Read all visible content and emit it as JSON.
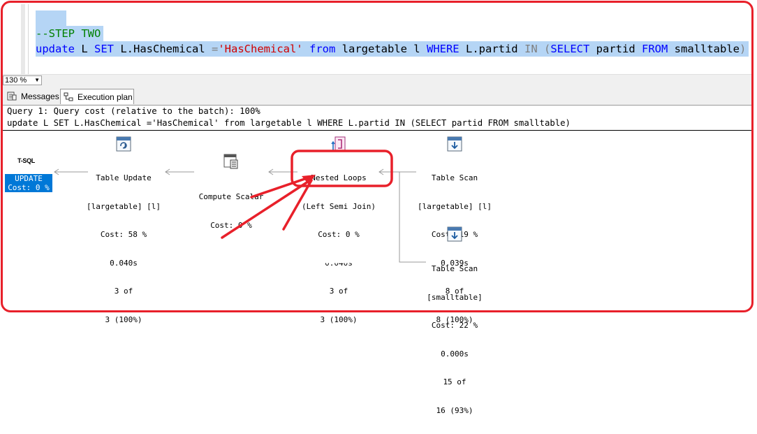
{
  "editor": {
    "comment": "--STEP TWO",
    "tokens": {
      "update": "update",
      "tbl_l": " L ",
      "set": "SET",
      "col": " L.HasChemical ",
      "eq": "=",
      "str": "'HasChemical'",
      "sp1": " ",
      "from1": "from",
      "lt": " largetable l ",
      "where": "WHERE",
      "partid": " L.partid ",
      "in": "IN",
      "sp2": " ",
      "paren": "(",
      "select": "SELECT",
      "partid2": " partid ",
      "from2": "FROM",
      "small": " smalltable",
      "paren2": ")"
    }
  },
  "zoom": {
    "value": "130 %"
  },
  "tabs": {
    "messages": "Messages",
    "execution_plan": "Execution plan"
  },
  "plan": {
    "query_line": "Query 1: Query cost (relative to the batch): 100%",
    "query_text": "update L SET L.HasChemical ='HasChemical' from largetable l WHERE L.partid IN (SELECT partid FROM smalltable)",
    "tsql_label": "T-SQL",
    "update_op": {
      "name": "UPDATE",
      "cost": "Cost: 0 %"
    },
    "table_update": {
      "name": "Table Update",
      "object": "[largetable] [l]",
      "cost": "Cost: 58 %",
      "time": "0.040s",
      "rows": "3 of",
      "estimate": "3 (100%)"
    },
    "compute_scalar": {
      "name": "Compute Scalar",
      "cost": "Cost: 0 %"
    },
    "nested_loops": {
      "name": "Nested Loops",
      "join": "(Left Semi Join)",
      "cost": "Cost: 0 %",
      "time": "0.040s",
      "rows": "3 of",
      "estimate": "3 (100%)"
    },
    "scan_large": {
      "name": "Table Scan",
      "object": "[largetable] [l]",
      "cost": "Cost: 19 %",
      "time": "0.039s",
      "rows": "8 of",
      "estimate": "8 (100%)"
    },
    "scan_small": {
      "name": "Table Scan",
      "object": "[smalltable]",
      "cost": "Cost: 22 %",
      "time": "0.000s",
      "rows": "15 of",
      "estimate": "16 (93%)"
    }
  },
  "colors": {
    "annotation": "#e8202a",
    "selection": "#b5d5f5",
    "keyword": "#0000ff",
    "string": "#d00000",
    "comment": "#008000",
    "update_bg": "#0078d7"
  }
}
